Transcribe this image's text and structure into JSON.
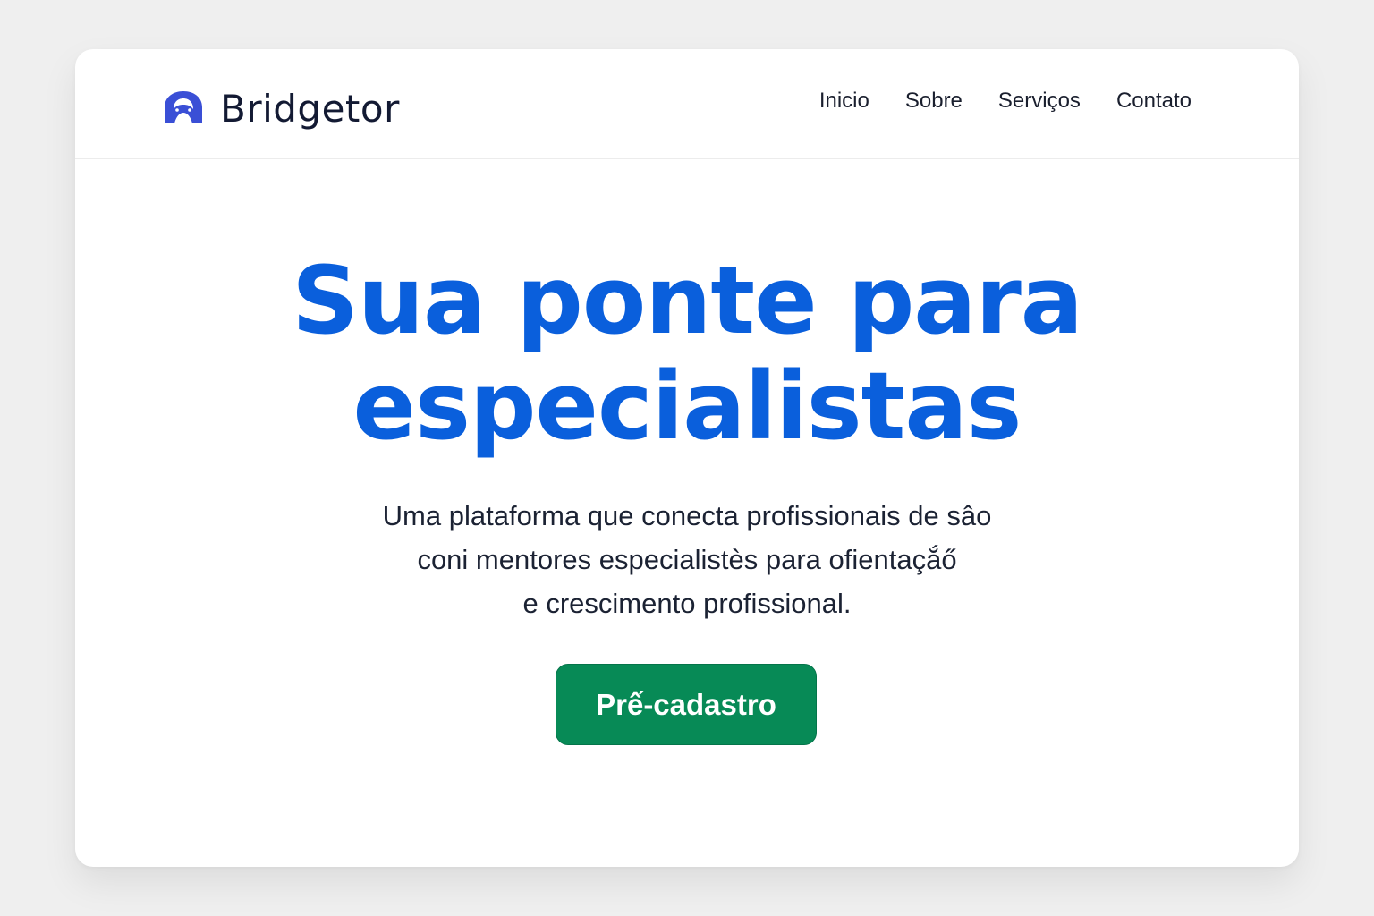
{
  "brand": {
    "name": "Bridgetor",
    "logo_icon": "bridge-mask-icon",
    "logo_color": "#3a4fd6"
  },
  "nav": {
    "items": [
      {
        "label": "Inicio"
      },
      {
        "label": "Sobre"
      },
      {
        "label": "Serviços"
      },
      {
        "label": "Contato"
      }
    ]
  },
  "hero": {
    "title_line1": "Sua ponte para",
    "title_line2": "especialistas",
    "subtitle_line1": "Uma plataforma que conecta profissionais de sâo",
    "subtitle_line2": "coni mentores especialistès para ofientaçắő",
    "subtitle_line3": "e crescimento profissional.",
    "cta_label": "Prế-cadastro"
  },
  "colors": {
    "title": "#0a5fdc",
    "cta_background": "#078a56",
    "page_background": "#efefef"
  }
}
